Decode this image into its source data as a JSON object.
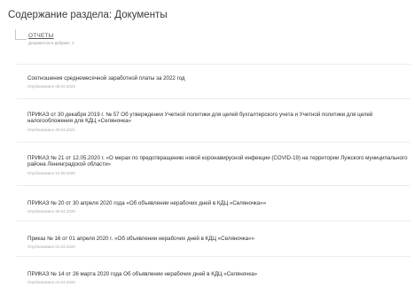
{
  "page": {
    "title": "Содержание раздела: Документы"
  },
  "category": {
    "label": "ОТЧЕТЫ",
    "count_text": "Документов в рубрике: 1"
  },
  "documents": [
    {
      "title": "Соотношения среднемесячной заработной платы за 2022 год",
      "date": "Опубликовано 06.03.2023"
    },
    {
      "title": "ПРИКАЗ от 30 декабря 2019 г. № 57 Об утверждении Учетной политики для целей бухгалтерского учета и Учетной политики для целей налогообложения для КДЦ «Селяночка»",
      "date": "Опубликовано 29.04.2021"
    },
    {
      "title": "ПРИКАЗ № 21 от 12.05.2020 г. «О мерах по предотвращению новой коронавирусной инфекции (COVID-19) на территории Лужского муниципального района Ленинградской области»",
      "date": "Опубликовано 12.05.2020"
    },
    {
      "title": "ПРИКАЗ № 20 от 30 апреля 2020 года «Об объявлении нерабочих дней в КДЦ «Селяночка»»",
      "date": "Опубликовано 30.04.2020"
    },
    {
      "title": "Приказ № 16 от 01 апреля 2020 г. «Об объявлении нерабочих дней в КДЦ «Селяночка»»",
      "date": "Опубликовано 01.04.2020"
    },
    {
      "title": "ПРИКАЗ № 14 от 26 марта 2020 года Об объявлении нерабочих дней в КДЦ «Селяночка»",
      "date": "Опубликовано 01.04.2020"
    }
  ]
}
